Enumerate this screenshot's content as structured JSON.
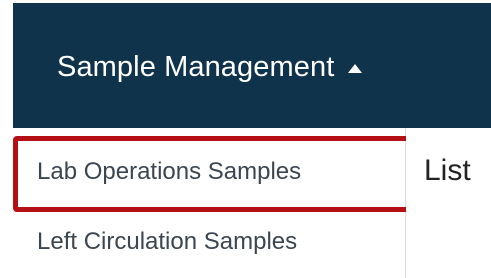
{
  "header": {
    "menu_label": "Sample Management",
    "caret_icon": "caret-up-icon",
    "background_color": "#0f334a"
  },
  "dropdown": {
    "items": [
      {
        "label": "Lab Operations Samples",
        "highlighted": true
      },
      {
        "label": "Left Circulation Samples",
        "highlighted": false
      }
    ],
    "highlight_color": "#b40f14"
  },
  "content": {
    "partial_label": "List"
  }
}
